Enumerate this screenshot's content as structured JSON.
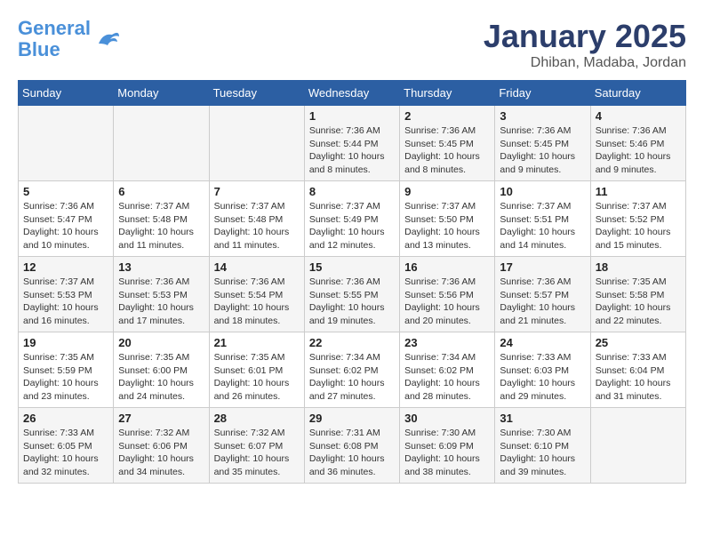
{
  "header": {
    "logo_line1": "General",
    "logo_line2": "Blue",
    "month": "January 2025",
    "location": "Dhiban, Madaba, Jordan"
  },
  "weekdays": [
    "Sunday",
    "Monday",
    "Tuesday",
    "Wednesday",
    "Thursday",
    "Friday",
    "Saturday"
  ],
  "weeks": [
    [
      {
        "day": "",
        "info": ""
      },
      {
        "day": "",
        "info": ""
      },
      {
        "day": "",
        "info": ""
      },
      {
        "day": "1",
        "info": "Sunrise: 7:36 AM\nSunset: 5:44 PM\nDaylight: 10 hours\nand 8 minutes."
      },
      {
        "day": "2",
        "info": "Sunrise: 7:36 AM\nSunset: 5:45 PM\nDaylight: 10 hours\nand 8 minutes."
      },
      {
        "day": "3",
        "info": "Sunrise: 7:36 AM\nSunset: 5:45 PM\nDaylight: 10 hours\nand 9 minutes."
      },
      {
        "day": "4",
        "info": "Sunrise: 7:36 AM\nSunset: 5:46 PM\nDaylight: 10 hours\nand 9 minutes."
      }
    ],
    [
      {
        "day": "5",
        "info": "Sunrise: 7:36 AM\nSunset: 5:47 PM\nDaylight: 10 hours\nand 10 minutes."
      },
      {
        "day": "6",
        "info": "Sunrise: 7:37 AM\nSunset: 5:48 PM\nDaylight: 10 hours\nand 11 minutes."
      },
      {
        "day": "7",
        "info": "Sunrise: 7:37 AM\nSunset: 5:48 PM\nDaylight: 10 hours\nand 11 minutes."
      },
      {
        "day": "8",
        "info": "Sunrise: 7:37 AM\nSunset: 5:49 PM\nDaylight: 10 hours\nand 12 minutes."
      },
      {
        "day": "9",
        "info": "Sunrise: 7:37 AM\nSunset: 5:50 PM\nDaylight: 10 hours\nand 13 minutes."
      },
      {
        "day": "10",
        "info": "Sunrise: 7:37 AM\nSunset: 5:51 PM\nDaylight: 10 hours\nand 14 minutes."
      },
      {
        "day": "11",
        "info": "Sunrise: 7:37 AM\nSunset: 5:52 PM\nDaylight: 10 hours\nand 15 minutes."
      }
    ],
    [
      {
        "day": "12",
        "info": "Sunrise: 7:37 AM\nSunset: 5:53 PM\nDaylight: 10 hours\nand 16 minutes."
      },
      {
        "day": "13",
        "info": "Sunrise: 7:36 AM\nSunset: 5:53 PM\nDaylight: 10 hours\nand 17 minutes."
      },
      {
        "day": "14",
        "info": "Sunrise: 7:36 AM\nSunset: 5:54 PM\nDaylight: 10 hours\nand 18 minutes."
      },
      {
        "day": "15",
        "info": "Sunrise: 7:36 AM\nSunset: 5:55 PM\nDaylight: 10 hours\nand 19 minutes."
      },
      {
        "day": "16",
        "info": "Sunrise: 7:36 AM\nSunset: 5:56 PM\nDaylight: 10 hours\nand 20 minutes."
      },
      {
        "day": "17",
        "info": "Sunrise: 7:36 AM\nSunset: 5:57 PM\nDaylight: 10 hours\nand 21 minutes."
      },
      {
        "day": "18",
        "info": "Sunrise: 7:35 AM\nSunset: 5:58 PM\nDaylight: 10 hours\nand 22 minutes."
      }
    ],
    [
      {
        "day": "19",
        "info": "Sunrise: 7:35 AM\nSunset: 5:59 PM\nDaylight: 10 hours\nand 23 minutes."
      },
      {
        "day": "20",
        "info": "Sunrise: 7:35 AM\nSunset: 6:00 PM\nDaylight: 10 hours\nand 24 minutes."
      },
      {
        "day": "21",
        "info": "Sunrise: 7:35 AM\nSunset: 6:01 PM\nDaylight: 10 hours\nand 26 minutes."
      },
      {
        "day": "22",
        "info": "Sunrise: 7:34 AM\nSunset: 6:02 PM\nDaylight: 10 hours\nand 27 minutes."
      },
      {
        "day": "23",
        "info": "Sunrise: 7:34 AM\nSunset: 6:02 PM\nDaylight: 10 hours\nand 28 minutes."
      },
      {
        "day": "24",
        "info": "Sunrise: 7:33 AM\nSunset: 6:03 PM\nDaylight: 10 hours\nand 29 minutes."
      },
      {
        "day": "25",
        "info": "Sunrise: 7:33 AM\nSunset: 6:04 PM\nDaylight: 10 hours\nand 31 minutes."
      }
    ],
    [
      {
        "day": "26",
        "info": "Sunrise: 7:33 AM\nSunset: 6:05 PM\nDaylight: 10 hours\nand 32 minutes."
      },
      {
        "day": "27",
        "info": "Sunrise: 7:32 AM\nSunset: 6:06 PM\nDaylight: 10 hours\nand 34 minutes."
      },
      {
        "day": "28",
        "info": "Sunrise: 7:32 AM\nSunset: 6:07 PM\nDaylight: 10 hours\nand 35 minutes."
      },
      {
        "day": "29",
        "info": "Sunrise: 7:31 AM\nSunset: 6:08 PM\nDaylight: 10 hours\nand 36 minutes."
      },
      {
        "day": "30",
        "info": "Sunrise: 7:30 AM\nSunset: 6:09 PM\nDaylight: 10 hours\nand 38 minutes."
      },
      {
        "day": "31",
        "info": "Sunrise: 7:30 AM\nSunset: 6:10 PM\nDaylight: 10 hours\nand 39 minutes."
      },
      {
        "day": "",
        "info": ""
      }
    ]
  ]
}
